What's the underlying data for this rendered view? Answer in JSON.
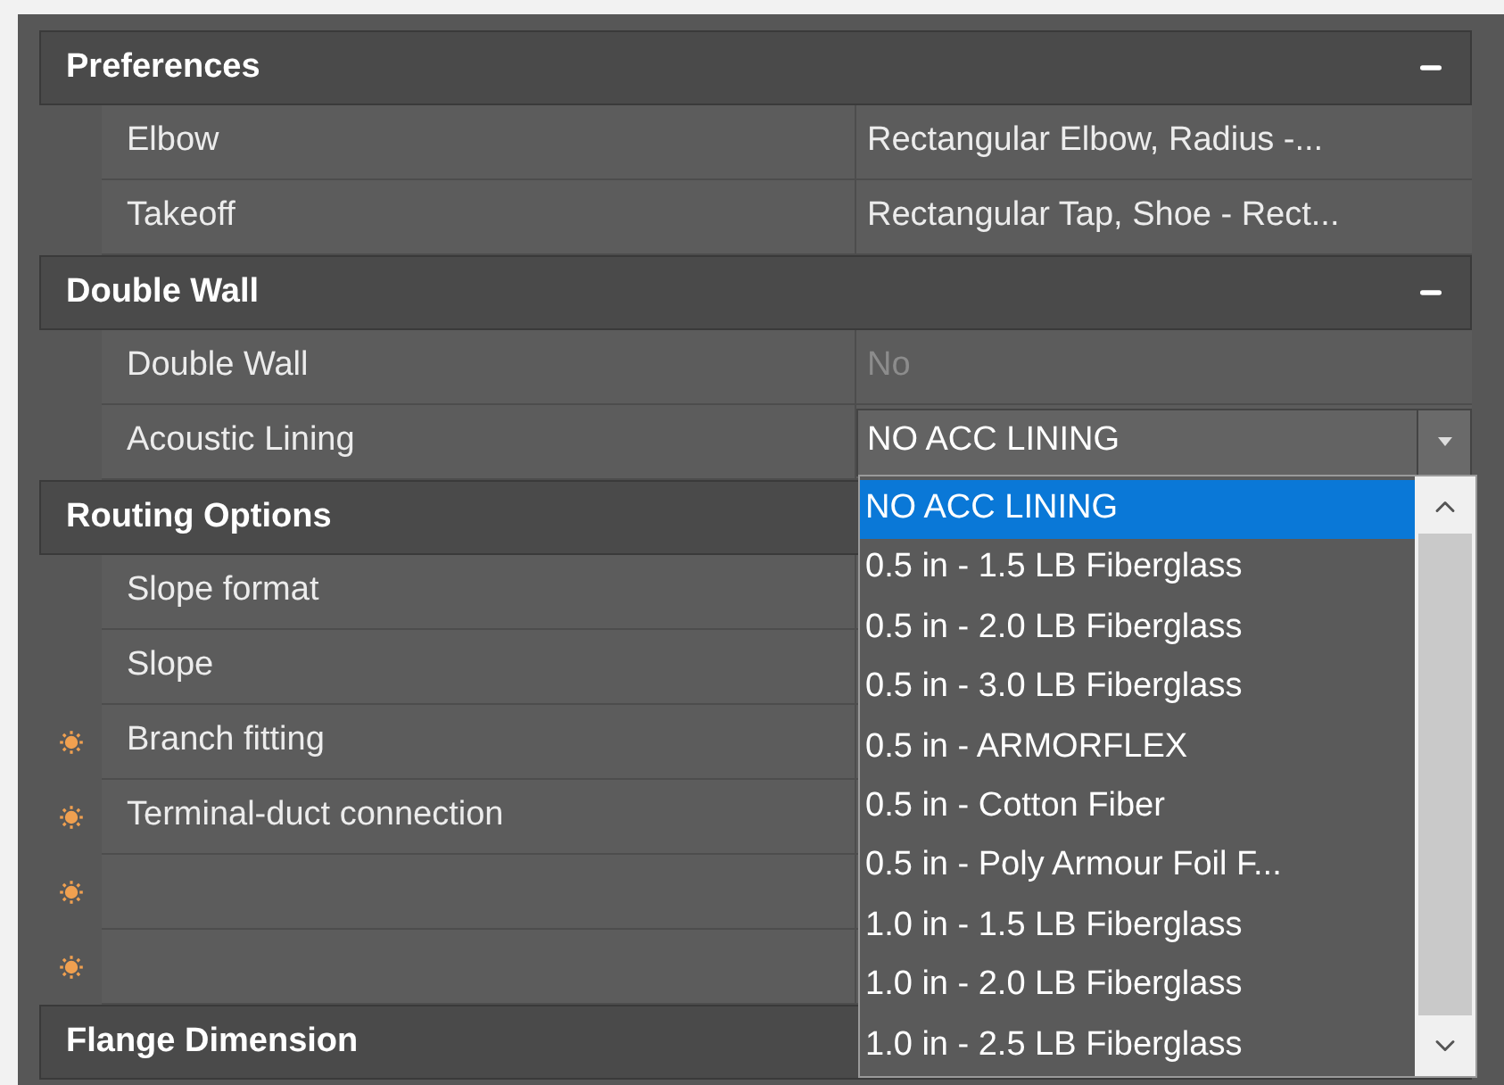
{
  "sections": [
    {
      "title": "Preferences",
      "expanded": true,
      "properties": [
        {
          "kind": "text",
          "name": "Elbow",
          "value": "Rectangular Elbow, Radius -...",
          "warning": false,
          "disabled": false
        },
        {
          "kind": "text",
          "name": "Takeoff",
          "value": "Rectangular Tap, Shoe - Rect...",
          "warning": false,
          "disabled": false
        }
      ]
    },
    {
      "title": "Double Wall",
      "expanded": true,
      "properties": [
        {
          "kind": "text",
          "name": "Double Wall",
          "value": "No",
          "warning": false,
          "disabled": true
        },
        {
          "kind": "combo",
          "name": "Acoustic Lining",
          "value": "NO ACC LINING",
          "warning": false,
          "open": true,
          "options": [
            {
              "label": "NO ACC LINING",
              "selected": true
            },
            {
              "label": "0.5 in - 1.5 LB Fiberglass",
              "selected": false
            },
            {
              "label": "0.5 in - 2.0 LB Fiberglass",
              "selected": false
            },
            {
              "label": "0.5 in - 3.0 LB Fiberglass",
              "selected": false
            },
            {
              "label": "0.5 in - ARMORFLEX",
              "selected": false
            },
            {
              "label": "0.5 in - Cotton Fiber",
              "selected": false
            },
            {
              "label": "0.5 in - Poly Armour Foil F...",
              "selected": false
            },
            {
              "label": "1.0 in - 1.5 LB Fiberglass",
              "selected": false
            },
            {
              "label": "1.0 in - 2.0 LB Fiberglass",
              "selected": false
            },
            {
              "label": "1.0 in - 2.5 LB Fiberglass",
              "selected": false
            }
          ]
        }
      ]
    },
    {
      "title": "Routing Options",
      "properties": [
        {
          "kind": "text",
          "name": "Slope format",
          "warning": false
        },
        {
          "kind": "text",
          "name": "Slope",
          "warning": false
        },
        {
          "kind": "text",
          "name": "Branch fitting",
          "warning": true
        },
        {
          "kind": "text",
          "name": "Terminal-duct connection",
          "warning": true
        },
        {
          "kind": "text",
          "warning": true
        },
        {
          "kind": "text",
          "warning": true
        }
      ]
    },
    {
      "title": "Flange Dimension"
    }
  ]
}
